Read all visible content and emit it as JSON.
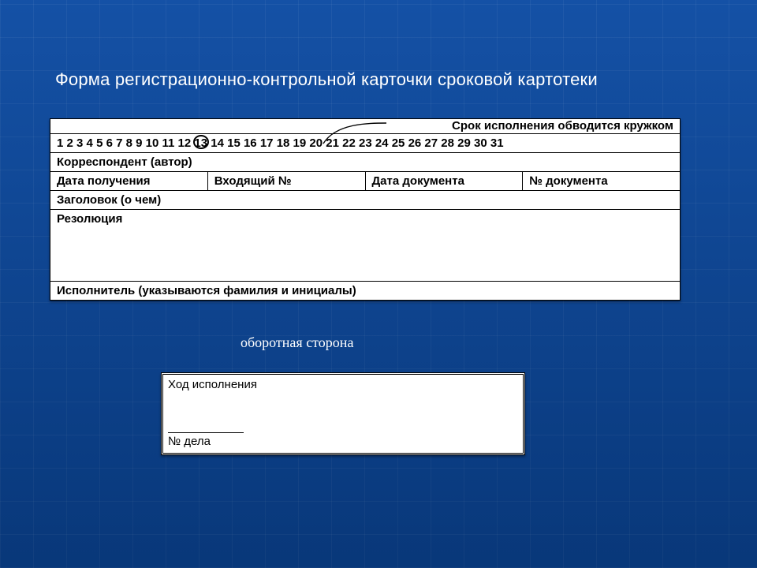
{
  "title": "Форма регистрационно-контрольной карточки сроковой картотеки",
  "front": {
    "callout": "Срок исполнения обводится кружком",
    "circled_day": 13,
    "correspondent": "Корреспондент (автор)",
    "cols": {
      "date_received": "Дата получения",
      "incoming_no": "Входящий №",
      "doc_date": "Дата документа",
      "doc_no": "№ документа"
    },
    "subject": "Заголовок (о чем)",
    "resolution": "Резолюция",
    "executor": "Исполнитель (указываются фамилия и инициалы)"
  },
  "mid_caption": "оборотная сторона",
  "back": {
    "progress": "Ход исполнения",
    "case_no": "№ дела"
  },
  "days": [
    1,
    2,
    3,
    4,
    5,
    6,
    7,
    8,
    9,
    10,
    11,
    12,
    13,
    14,
    15,
    16,
    17,
    18,
    19,
    20,
    21,
    22,
    23,
    24,
    25,
    26,
    27,
    28,
    29,
    30,
    31
  ]
}
